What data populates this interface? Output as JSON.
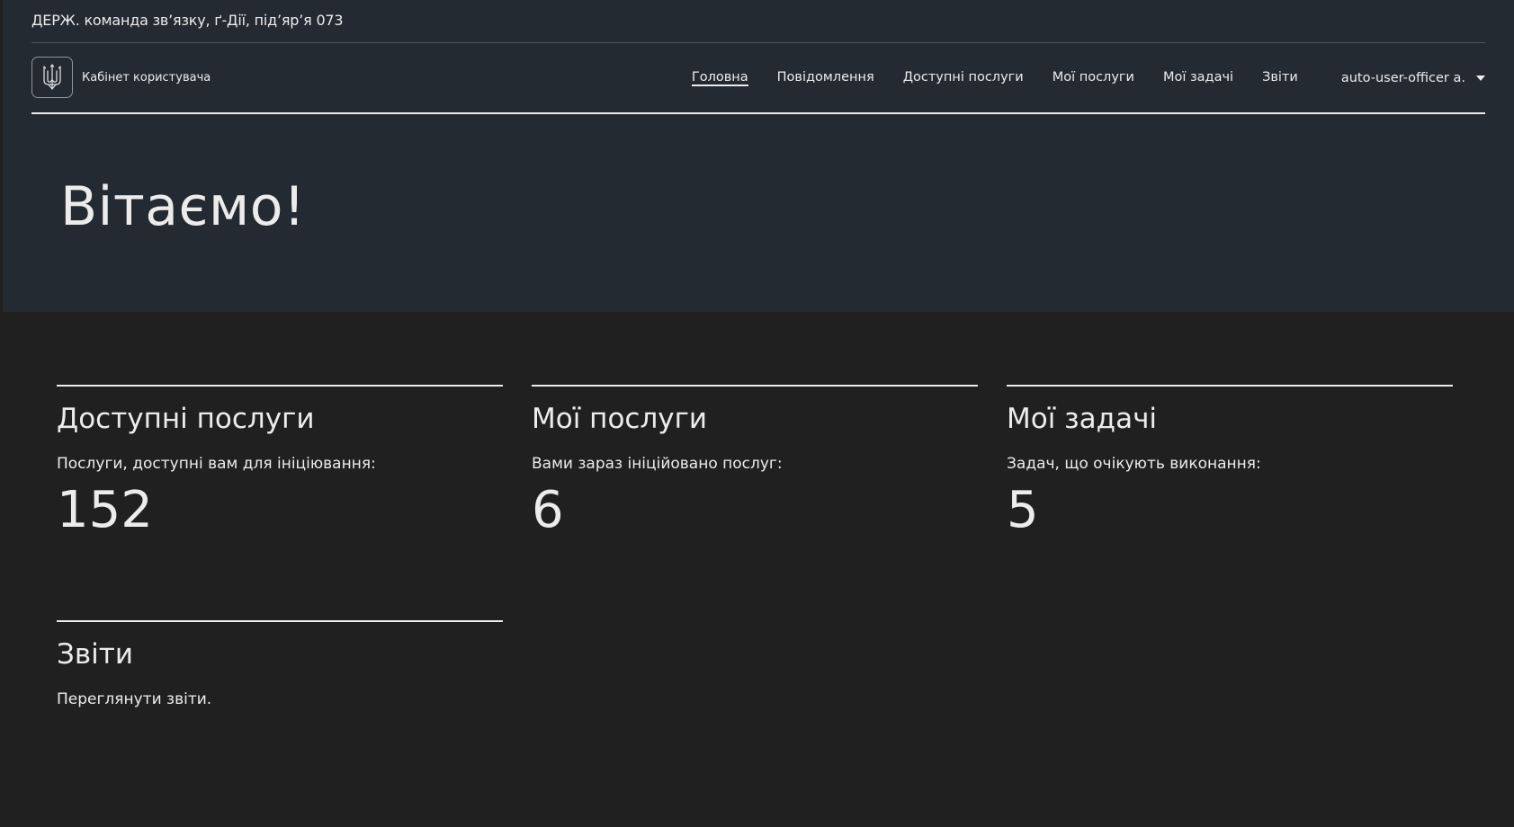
{
  "org": {
    "name": "ДЕРЖ. команда зв’язку, ґ-Дії, під’яр’я 073"
  },
  "brand": {
    "logo_icon": "trident-icon",
    "label": "Кабінет користувача"
  },
  "nav": {
    "items": [
      {
        "label": "Головна",
        "active": true
      },
      {
        "label": "Повідомлення",
        "active": false
      },
      {
        "label": "Доступні послуги",
        "active": false
      },
      {
        "label": "Мої послуги",
        "active": false
      },
      {
        "label": "Мої задачі",
        "active": false
      },
      {
        "label": "Звіти",
        "active": false
      }
    ],
    "user": {
      "name": "auto-user-officer a.",
      "icon": "chevron-down-icon"
    }
  },
  "hero": {
    "title": "Вітаємо!"
  },
  "cards": [
    {
      "title": "Доступні послуги",
      "text": "Послуги, доступні вам для ініціювання:",
      "count": "152"
    },
    {
      "title": "Мої послуги",
      "text": "Вами зараз ініційовано послуг:",
      "count": "6"
    },
    {
      "title": "Мої задачі",
      "text": "Задач, що очікують виконання:",
      "count": "5"
    },
    {
      "title": "Звіти",
      "text": "Переглянути звіти."
    }
  ],
  "colors": {
    "header_background": "#242a31",
    "page_background": "#202020",
    "text": "#ececec"
  }
}
